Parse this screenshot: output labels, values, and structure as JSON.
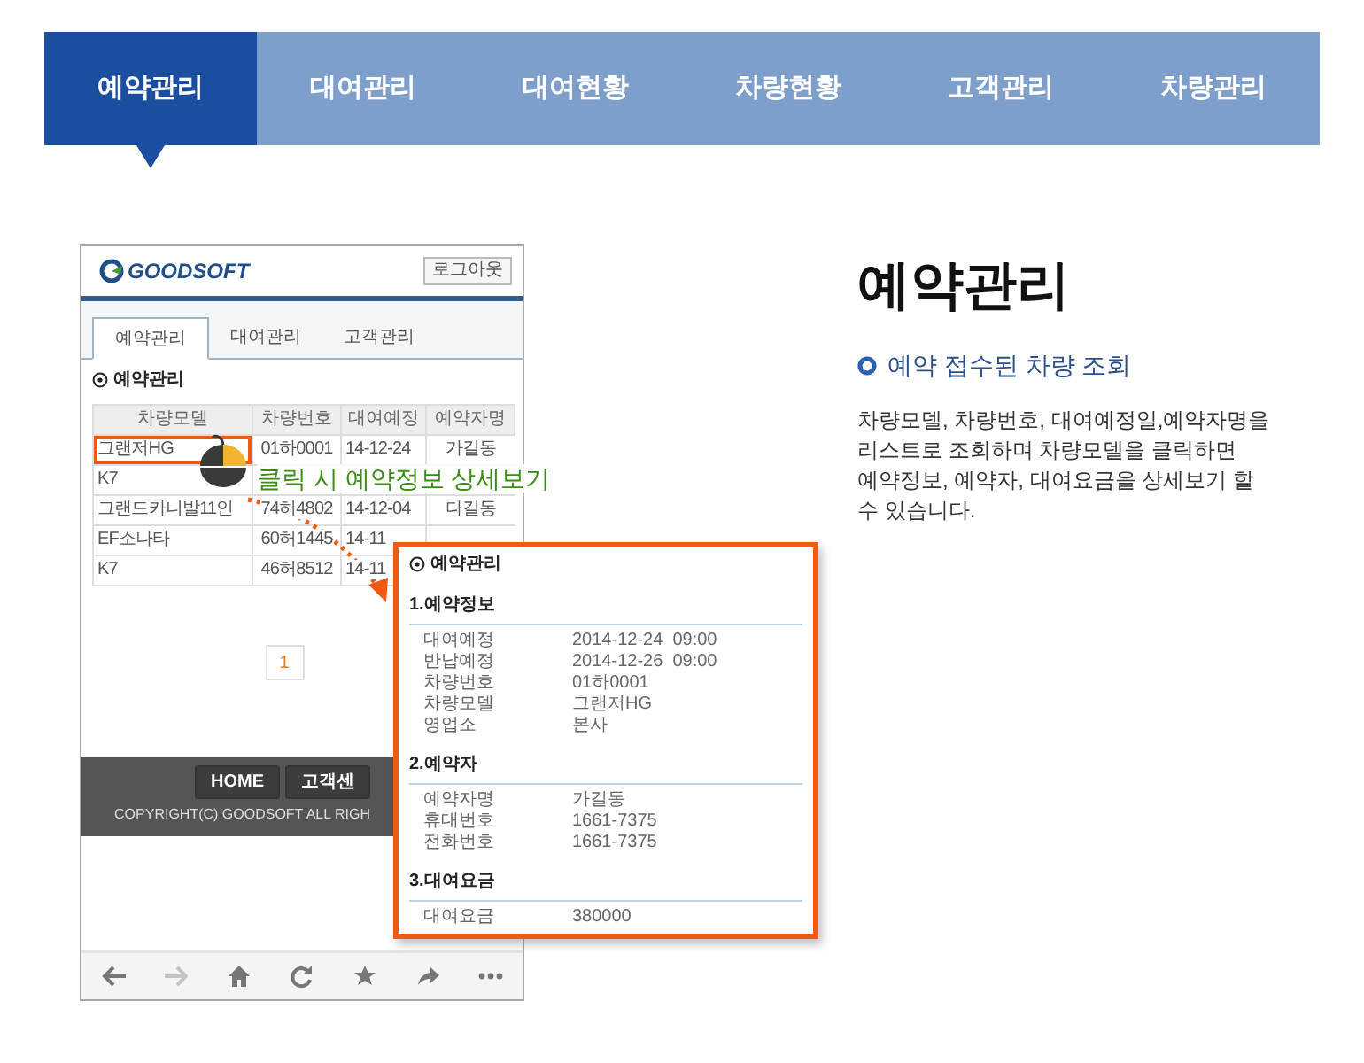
{
  "nav": {
    "tabs": [
      {
        "label": "예약관리",
        "selected": true
      },
      {
        "label": "대여관리",
        "selected": false
      },
      {
        "label": "대여현황",
        "selected": false
      },
      {
        "label": "차량현황",
        "selected": false
      },
      {
        "label": "고객관리",
        "selected": false
      },
      {
        "label": "차량관리",
        "selected": false
      }
    ]
  },
  "phone": {
    "logo": "GOODSOFT",
    "logout": "로그아웃",
    "tabs": [
      {
        "label": "예약관리",
        "selected": true
      },
      {
        "label": "대여관리",
        "selected": false
      },
      {
        "label": "고객관리",
        "selected": false
      }
    ],
    "section_title": "예약관리",
    "table": {
      "columns": [
        "차량모델",
        "차량번호",
        "대여예정",
        "예약자명"
      ],
      "rows": [
        {
          "highlighted": true,
          "cells": [
            "그랜저HG",
            "01하0001",
            "14-12-24",
            "가길동"
          ]
        },
        {
          "highlighted": false,
          "cells": [
            "K7"
          ]
        },
        {
          "highlighted": false,
          "cells": [
            "그랜드카니발11인",
            "74허4802",
            "14-12-04",
            "다길동"
          ]
        },
        {
          "highlighted": false,
          "cells": [
            "EF소나타",
            "60허1445",
            "14-11"
          ]
        },
        {
          "highlighted": false,
          "cells": [
            "K7",
            "46허8512",
            "14-11"
          ]
        }
      ]
    },
    "pagination": [
      {
        "label": "1",
        "selected": true
      }
    ],
    "footer": {
      "buttons": [
        "HOME",
        "고객센"
      ],
      "copyright": "COPYRIGHT(C) GOODSOFT ALL RIGH"
    },
    "browser_bar": [
      {
        "kind": "back",
        "disabled": false
      },
      {
        "kind": "forward",
        "disabled": true
      },
      {
        "kind": "home",
        "disabled": false
      },
      {
        "kind": "refresh",
        "disabled": false
      },
      {
        "kind": "star",
        "disabled": false
      },
      {
        "kind": "share",
        "disabled": false
      },
      {
        "kind": "more",
        "disabled": false
      }
    ]
  },
  "callout": "클릭 시 예약정보 상세보기",
  "popup": {
    "title": "예약관리",
    "sections": [
      {
        "heading": "1.예약정보",
        "rows": [
          [
            "대여예정",
            "2014-12-24  09:00"
          ],
          [
            "반납예정",
            "2014-12-26  09:00"
          ],
          [
            "차량번호",
            "01하0001"
          ],
          [
            "차량모델",
            "그랜저HG"
          ],
          [
            "영업소",
            "본사"
          ]
        ]
      },
      {
        "heading": "2.예약자",
        "rows": [
          [
            "예약자명",
            "가길동"
          ],
          [
            "휴대번호",
            "1661-7375"
          ],
          [
            "전화번호",
            "1661-7375"
          ]
        ]
      },
      {
        "heading": "3.대여요금",
        "rows": [
          [
            "대여요금",
            "380000"
          ]
        ]
      }
    ]
  },
  "info": {
    "title": "예약관리",
    "subtitle": "예약 접수된 차량 조회",
    "description": "차량모델, 차량번호, 대여예정일,예약자명을 리스트로 조회하며 차량모델을 클릭하면 예약정보, 예약자, 대여요금을 상세보기 할 수 있습니다."
  }
}
